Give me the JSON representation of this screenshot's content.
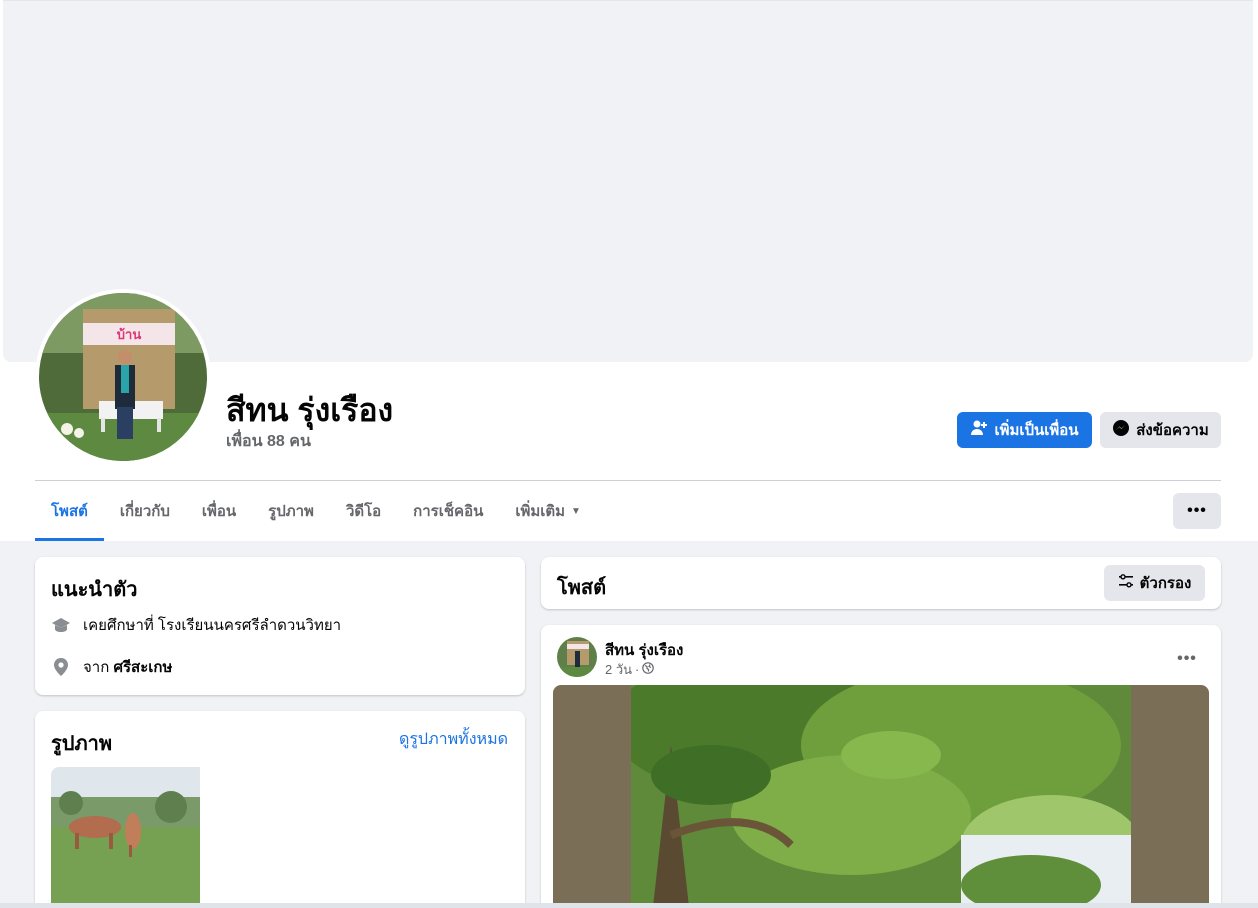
{
  "profile": {
    "name": "สีทน รุ่งเรือง",
    "friends": "เพื่อน 88 คน"
  },
  "actions": {
    "add_friend": "เพิ่มเป็นเพื่อน",
    "message": "ส่งข้อความ",
    "more": "•••"
  },
  "tabs": [
    {
      "label": "โพสต์",
      "active": true
    },
    {
      "label": "เกี่ยวกับ"
    },
    {
      "label": "เพื่อน"
    },
    {
      "label": "รูปภาพ"
    },
    {
      "label": "วิดีโอ"
    },
    {
      "label": "การเช็คอิน"
    },
    {
      "label": "เพิ่มเติม"
    }
  ],
  "intro": {
    "title": "แนะนำตัว",
    "education": "เคยศึกษาที่ โรงเรียนนครศรีลำดวนวิทยา",
    "from_prefix": "จาก",
    "from_place": "ศรีสะเกษ"
  },
  "photos": {
    "title": "รูปภาพ",
    "see_all": "ดูรูปภาพทั้งหมด"
  },
  "posts": {
    "title": "โพสต์",
    "filter": "ตัวกรอง"
  },
  "post": {
    "author": "สีทน รุ่งเรือง",
    "time": "2 วัน",
    "separator": "·",
    "more": "•••"
  },
  "icons": {
    "education": "graduation-cap-icon",
    "location": "location-pin-icon",
    "messenger": "messenger-icon",
    "add_friend": "add-person-icon",
    "filter": "filter-sliders-icon",
    "privacy": "globe-icon"
  },
  "colors": {
    "accent": "#1b74e4",
    "background": "#f0f2f5",
    "secondary_button": "#e4e6eb",
    "muted_text": "#65676b"
  }
}
